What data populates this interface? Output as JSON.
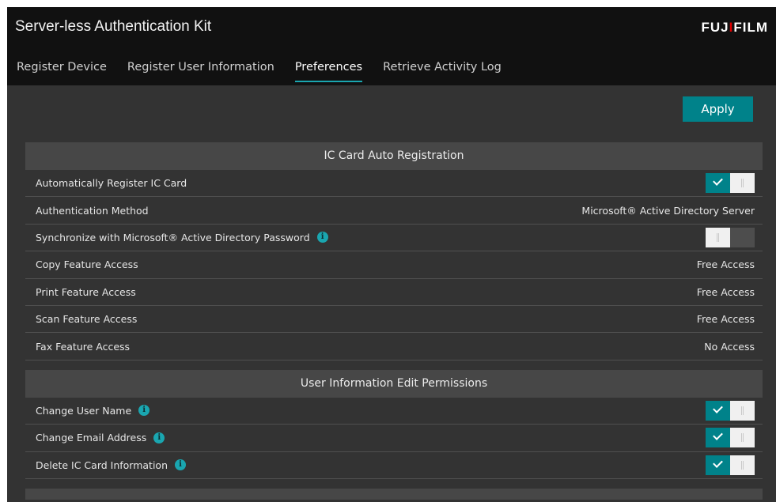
{
  "app": {
    "title": "Server-less Authentication Kit",
    "brand_prefix": "FUJ",
    "brand_dot": "I",
    "brand_suffix": "FILM"
  },
  "tabs": [
    {
      "label": "Register Device",
      "active": false
    },
    {
      "label": "Register User Information",
      "active": false
    },
    {
      "label": "Preferences",
      "active": true
    },
    {
      "label": "Retrieve Activity Log",
      "active": false
    }
  ],
  "toolbar": {
    "apply_label": "Apply"
  },
  "sections": [
    {
      "title": "IC Card Auto Registration",
      "rows": [
        {
          "label": "Automatically Register IC Card",
          "type": "toggle",
          "on": true,
          "info": false
        },
        {
          "label": "Authentication Method",
          "type": "value",
          "value": "Microsoft® Active Directory Server",
          "info": false
        },
        {
          "label": "Synchronize with Microsoft® Active Directory Password",
          "type": "toggle",
          "on": false,
          "info": true
        },
        {
          "label": "Copy Feature Access",
          "type": "value",
          "value": "Free Access",
          "info": false
        },
        {
          "label": "Print Feature Access",
          "type": "value",
          "value": "Free Access",
          "info": false
        },
        {
          "label": "Scan Feature Access",
          "type": "value",
          "value": "Free Access",
          "info": false
        },
        {
          "label": "Fax Feature Access",
          "type": "value",
          "value": "No Access",
          "info": false
        }
      ]
    },
    {
      "title": "User Information Edit Permissions",
      "rows": [
        {
          "label": "Change User Name",
          "type": "toggle",
          "on": true,
          "info": true
        },
        {
          "label": "Change Email Address",
          "type": "toggle",
          "on": true,
          "info": true
        },
        {
          "label": "Delete IC Card Information",
          "type": "toggle",
          "on": true,
          "info": true
        }
      ]
    }
  ],
  "icons": {
    "info": "info-icon",
    "check": "check-icon"
  },
  "colors": {
    "accent": "#00828a",
    "info": "#1aa6b0",
    "background": "#333333",
    "header": "#111111",
    "brand_dot": "#e00000"
  }
}
